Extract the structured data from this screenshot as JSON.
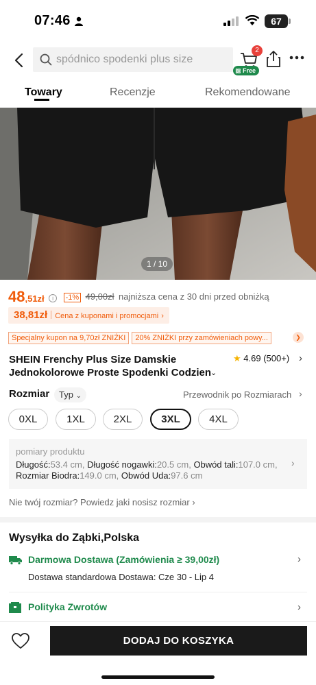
{
  "status_bar": {
    "time": "07:46",
    "battery": "67"
  },
  "header": {
    "search_placeholder": "spódnico spodenki plus size",
    "cart_count": "2",
    "free_label": "Free"
  },
  "tabs": [
    {
      "label": "Towary",
      "active": true
    },
    {
      "label": "Recenzje",
      "active": false
    },
    {
      "label": "Rekomendowane",
      "active": false
    }
  ],
  "gallery": {
    "counter": "1 / 10"
  },
  "price": {
    "current_main": "48",
    "current_cents": ",51zł",
    "discount": "-1%",
    "old": "49,00zł",
    "lowest_note": "najniższa cena z 30 dni przed obniżką"
  },
  "coupon_price": {
    "value": "38,81zł",
    "text": "Cena z kuponami i promocjami",
    "arrow": "›"
  },
  "promos": [
    "Specjalny kupon na 9,70zł ZNIŻKI",
    "20% ZNIŻKI przy zamówieniach powy..."
  ],
  "product": {
    "title_line1": "SHEIN Frenchy Plus Size Damskie",
    "title_line2": "Jednokolorowe Proste Spodenki Codzien",
    "rating": "4.69",
    "reviews": "(500+)"
  },
  "size": {
    "label": "Rozmiar",
    "type_label": "Typ",
    "guide": "Przewodnik po Rozmiarach",
    "options": [
      "0XL",
      "1XL",
      "2XL",
      "3XL",
      "4XL"
    ],
    "selected": "3XL"
  },
  "measurements": {
    "heading": "pomiary produktu",
    "length_label": "Długość:",
    "length_value": "53.4 cm,",
    "inseam_label": "Długość nogawki:",
    "inseam_value": "20.5 cm,",
    "waist_label": "Obwód tali:",
    "waist_value": "107.0 cm,",
    "hip_label": "Rozmiar Biodra:",
    "hip_value": "149.0 cm,",
    "thigh_label": "Obwód Uda:",
    "thigh_value": "97.6 cm"
  },
  "not_your_size": "Nie twój rozmiar? Powiedz jaki nosisz rozmiar",
  "shipping": {
    "title": "Wysyłka do Ząbki,Polska",
    "free": "Darmowa Dostawa (Zamówienia ≥ 39,00zł)",
    "standard": "Dostawa standardowa Dostawa: Cze 30 - Lip 4",
    "returns": "Polityka Zwrotów"
  },
  "bottom": {
    "add_to_cart": "DODAJ DO KOSZYKA"
  },
  "colors": {
    "accent": "#f05c0b",
    "green": "#1f8a4c",
    "badge": "#e8413b"
  }
}
